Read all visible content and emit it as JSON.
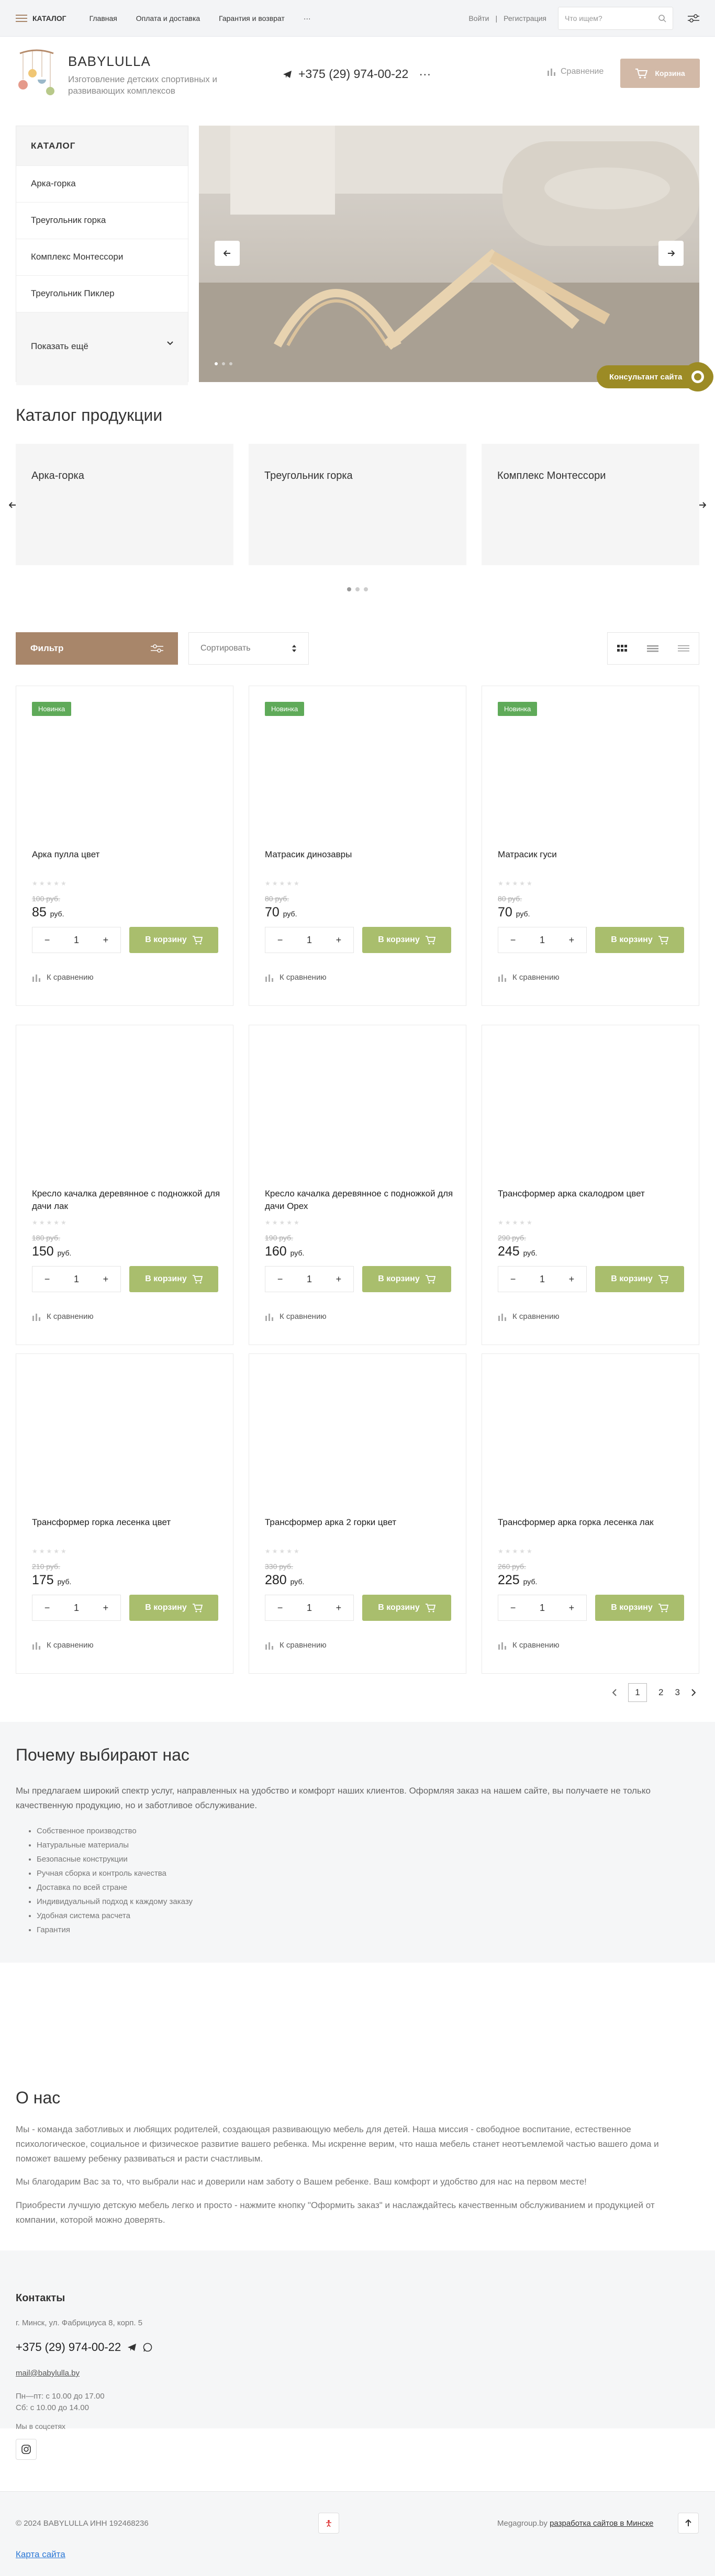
{
  "topbar": {
    "catalog_label": "КАТАЛОГ",
    "nav": [
      "Главная",
      "Оплата и доставка",
      "Гарантия и возврат"
    ],
    "more": "···",
    "login": "Войти",
    "separator": "|",
    "register": "Регистрация",
    "search_placeholder": "Что ищем?"
  },
  "header": {
    "brand": "BABYLULLA",
    "tagline": "Изготовление детских спортивных и развивающих комплексов",
    "phone": "+375 (29) 974-00-22",
    "phone_more": "···",
    "compare": "Сравнение",
    "basket": "Корзина"
  },
  "catalog_menu": {
    "title": "КАТАЛОГ",
    "items": [
      "Арка-горка",
      "Треугольник горка",
      "Комплекс Монтессори",
      "Треугольник Пиклер"
    ],
    "more": "Показать ещё"
  },
  "consult": "Консультант сайта",
  "section_catalog": {
    "title": "Каталог продукции",
    "cards": [
      "Арка-горка",
      "Треугольник горка",
      "Комплекс Монтессори"
    ]
  },
  "toolbar": {
    "filter": "Фильтр",
    "sort": "Сортировать"
  },
  "products": [
    {
      "badge": "Новинка",
      "name": "Арка пулла цвет",
      "old": "100 руб.",
      "price": "85",
      "unit": "руб."
    },
    {
      "badge": "Новинка",
      "name": "Матрасик динозавры",
      "old": "80 руб.",
      "price": "70",
      "unit": "руб."
    },
    {
      "badge": "Новинка",
      "name": "Матрасик гуси",
      "old": "80 руб.",
      "price": "70",
      "unit": "руб."
    },
    {
      "badge": "",
      "name": "Кресло качалка деревянное с подножкой для дачи лак",
      "old": "180 руб.",
      "price": "150",
      "unit": "руб."
    },
    {
      "badge": "",
      "name": "Кресло качалка деревянное с подножкой для дачи Орех",
      "old": "190 руб.",
      "price": "160",
      "unit": "руб."
    },
    {
      "badge": "",
      "name": "Трансформер арка скалодром цвет",
      "old": "290 руб.",
      "price": "245",
      "unit": "руб."
    },
    {
      "badge": "",
      "name": "Трансформер горка лесенка цвет",
      "old": "210 руб.",
      "price": "175",
      "unit": "руб."
    },
    {
      "badge": "",
      "name": "Трансформер арка 2 горки цвет",
      "old": "330 руб.",
      "price": "280",
      "unit": "руб."
    },
    {
      "badge": "",
      "name": "Трансформер арка горка лесенка лак",
      "old": "260 руб.",
      "price": "225",
      "unit": "руб."
    }
  ],
  "product_ui": {
    "qty": "1",
    "minus": "−",
    "plus": "+",
    "cart": "В корзину",
    "compare": "К сравнению"
  },
  "pager": {
    "pages": [
      "1",
      "2",
      "3"
    ],
    "current": "1"
  },
  "why": {
    "title": "Почему выбирают нас",
    "lead": "Мы предлагаем широкий спектр услуг, направленных на удобство и комфорт наших клиентов. Оформляя заказ на нашем сайте, вы получаете не только качественную продукцию, но и заботливое обслуживание.",
    "items": [
      "Собственное производство",
      "Натуральные материалы",
      "Безопасные конструкции",
      "Ручная сборка и контроль качества",
      "Доставка по всей стране",
      "Индивидуальный подход к каждому заказу",
      "Удобная система расчета",
      "Гарантия"
    ]
  },
  "about": {
    "title": "О нас",
    "p1": "Мы - команда заботливых и любящих родителей, создающая развивающую мебель для детей. Наша миссия - свободное воспитание, естественное психологическое, социальное и физическое развитие вашего ребенка. Мы искренне верим, что наша мебель станет неотъемлемой частью вашего дома и поможет вашему ребенку развиваться и расти счастливым.",
    "p2": "Мы благодарим Вас за то, что выбрали нас и доверили нам заботу о Вашем ребенке. Ваш комфорт и удобство для нас на первом месте!",
    "p3": "Приобрести лучшую детскую мебель легко и просто - нажмите кнопку \"Оформить заказ\" и наслаждайтесь качественным обслуживанием и продукцией от компании, которой можно доверять."
  },
  "contacts": {
    "title": "Контакты",
    "address": "г. Минск, ул. Фабрициуса 8, корп. 5",
    "phone": "+375 (29) 974-00-22",
    "email": "mail@babylulla.by",
    "hours1": "Пн—пт: с 10.00 до 17.00",
    "hours2": "Сб: с 10.00 до 14.00",
    "social": "Мы в соцсетях"
  },
  "footer": {
    "copyright": "© 2024 BABYLULLA ИНН 192468236",
    "dev_prefix": "Megagroup.by",
    "dev_link": "разработка сайтов в Минске",
    "sitemap": "Карта сайта"
  },
  "colors": {
    "accent": "#a8866a",
    "cart": "#a9be6d",
    "badge": "#5faa59",
    "consult": "#9c8b25"
  }
}
